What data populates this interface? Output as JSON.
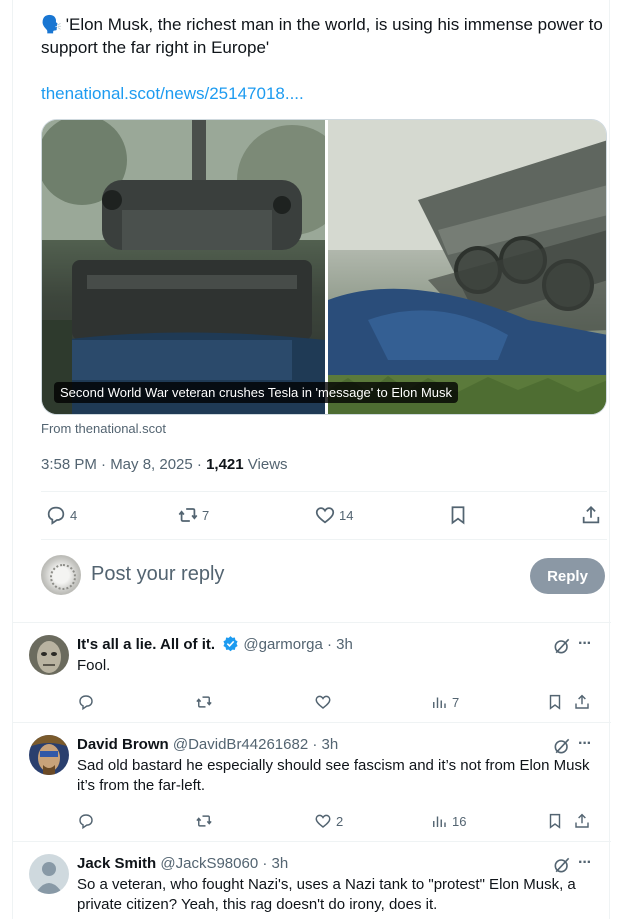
{
  "post": {
    "text": "'Elon Musk, the richest man in the world, is using his immense power to support the far right in Europe'",
    "emoji": "🗣️",
    "link": "thenational.scot/news/25147018....",
    "card_caption": "Second World War veteran crushes Tesla in 'message' to Elon Musk",
    "card_source": "From thenational.scot",
    "time": "3:58 PM · May 8, 2025 · ",
    "views_count": "1,421",
    "views_label": " Views",
    "actions": {
      "replies": "4",
      "reposts": "7",
      "likes": "14"
    }
  },
  "compose": {
    "placeholder": "Post your reply",
    "button": "Reply"
  },
  "replies": [
    {
      "name": "It's all a lie. All of it.",
      "verified": true,
      "handle": "@garmorga",
      "time": "· 3h",
      "text": "Fool.",
      "replies": "",
      "reposts": "",
      "likes": "",
      "views": "7"
    },
    {
      "name": "David Brown",
      "verified": false,
      "handle": "@DavidBr44261682",
      "time": "· 3h",
      "text": "Sad old bastard he especially should see fascism and it’s not from Elon Musk it’s from the far-left.",
      "replies": "",
      "reposts": "",
      "likes": "2",
      "views": "16"
    },
    {
      "name": "Jack Smith",
      "verified": false,
      "handle": "@JackS98060",
      "time": "· 3h",
      "text": "So a veteran, who fought Nazi's, uses a Nazi tank to \"protest\" Elon Musk, a private citizen? Yeah, this rag doesn't do irony, does it.",
      "replies": "",
      "reposts": "",
      "likes": "",
      "views": ""
    }
  ],
  "colors": {
    "link": "#1d9bf0",
    "secondary_text": "#536471",
    "reply_button_bg": "#8b98a5",
    "verified": "#1d9bf0"
  },
  "icons": [
    "reply-icon",
    "repost-icon",
    "like-icon",
    "bookmark-icon",
    "share-icon",
    "views-icon",
    "grok-icon",
    "more-icon",
    "verified-icon"
  ]
}
